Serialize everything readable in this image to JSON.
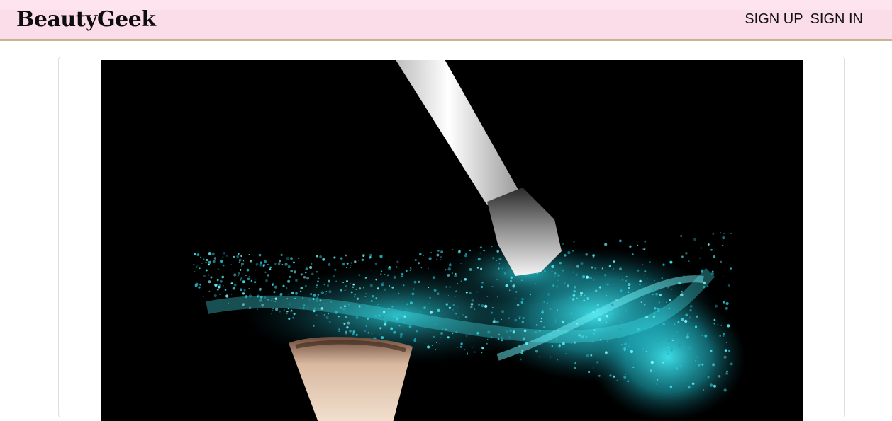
{
  "navbar": {
    "brand": "BeautyGeek",
    "links": [
      "SIGN UP",
      "SIGN IN"
    ],
    "background": "#fbdde9",
    "border_color": "#c8b48e"
  },
  "hero": {
    "image": "makeup-brushes-teal-powder-photo",
    "background": "#000000",
    "powder_color": "#27d3df"
  }
}
